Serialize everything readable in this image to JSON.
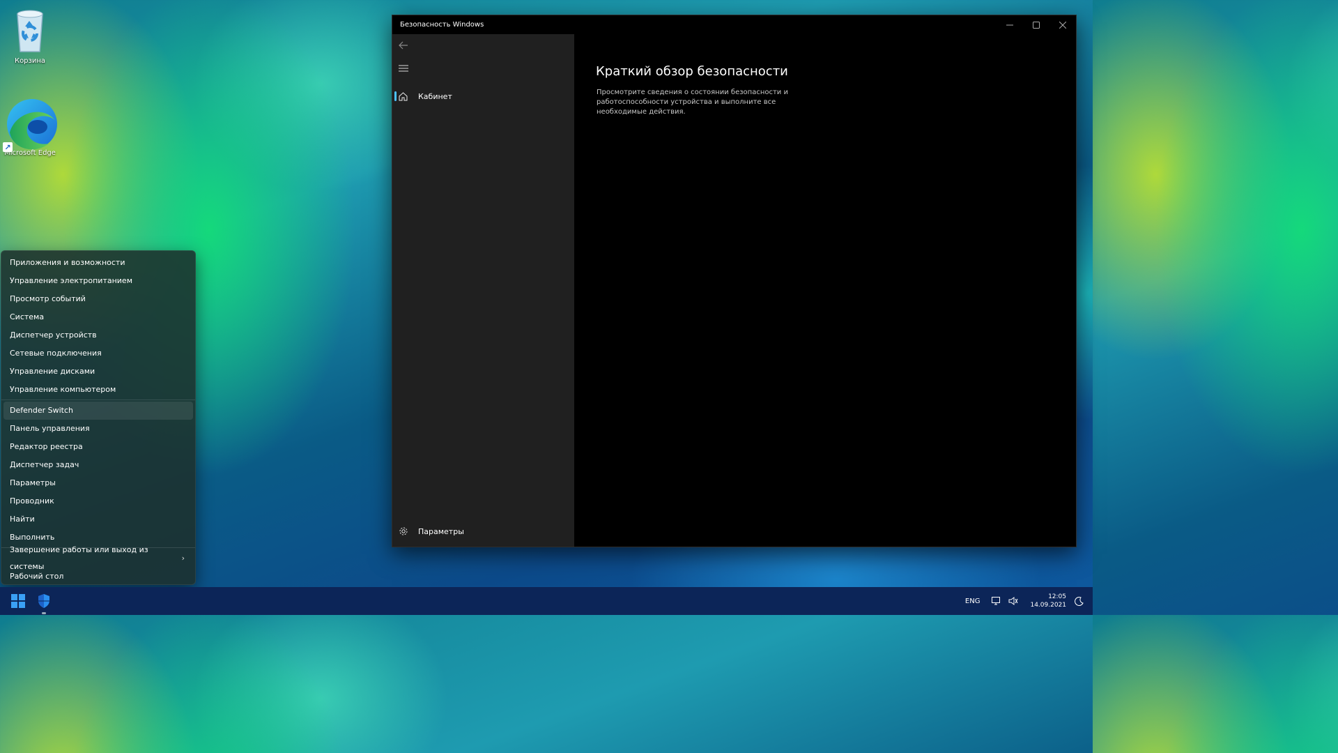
{
  "desktop": {
    "icons": [
      {
        "label": "Корзина",
        "icon": "recycle-bin-icon"
      },
      {
        "label": "Microsoft Edge",
        "icon": "edge-icon"
      }
    ]
  },
  "context_menu": {
    "groups": [
      [
        "Приложения и возможности",
        "Управление электропитанием",
        "Просмотр событий",
        "Система",
        "Диспетчер устройств",
        "Сетевые подключения",
        "Управление дисками",
        "Управление компьютером"
      ],
      [
        "Defender Switch",
        "Панель управления",
        "Редактор реестра",
        "Диспетчер задач",
        "Параметры",
        "Проводник",
        "Найти",
        "Выполнить"
      ],
      [
        "Завершение работы или выход из системы",
        "Рабочий стол"
      ]
    ],
    "highlighted": "Defender Switch"
  },
  "window": {
    "title": "Безопасность Windows",
    "sidebar": {
      "home_label": "Кабинет",
      "settings_label": "Параметры"
    },
    "content": {
      "heading": "Краткий обзор безопасности",
      "description": "Просмотрите сведения о состоянии безопасности и работоспособности устройства и выполните все необходимые действия."
    }
  },
  "taskbar": {
    "language": "ENG",
    "time": "12:05",
    "date": "14.09.2021",
    "accent": "#0c2558"
  }
}
